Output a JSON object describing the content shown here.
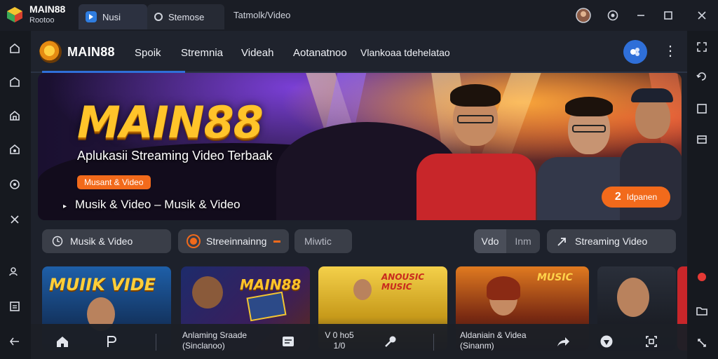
{
  "window": {
    "app_name": "MAIN88",
    "app_sub": "Rootoo",
    "tabs": [
      {
        "label": "Nusi"
      },
      {
        "label": "Stemose"
      },
      {
        "label": "Tatmolk/Video"
      }
    ]
  },
  "nav": {
    "brand": "MAIN88",
    "items": [
      "Spoik",
      "Stremnia",
      "Videah",
      "Aotanatnoo",
      "Vlankoaa tdehelatao"
    ]
  },
  "hero": {
    "title": "MAIN88",
    "subtitle": "Aplukasii Streaming Video Terbaak",
    "badge": "Musant & Video",
    "tagline": "Musik & Video – Musik & Video",
    "counter_number": "2",
    "counter_label": "Idpanen"
  },
  "chips": {
    "musik": "Musik & Video",
    "streaming": "Streeinnainng",
    "music": "Miwtic",
    "segment_left": "Vdo",
    "segment_right": "Inm",
    "streaming_video": "Streaming Video"
  },
  "thumbnails": [
    {
      "title": "MUIIK VIDE"
    },
    {
      "title": "MAIN88"
    },
    {
      "title": "ANOUSIC MUSIC"
    },
    {
      "title": "MUSIC"
    },
    {
      "title": ""
    }
  ],
  "bottombar": {
    "left_line1": "Anlaming Sraade",
    "left_line2": "(Sinclanoo)",
    "mid_line1": "V 0 ho5",
    "mid_line2": "1/0",
    "right_line1": "Aldaniain & Videa",
    "right_line2": "(Sinanm)"
  },
  "colors": {
    "accent_blue": "#2f6fd8",
    "accent_orange": "#f26a1b",
    "title_gold": "#ffc42a"
  }
}
